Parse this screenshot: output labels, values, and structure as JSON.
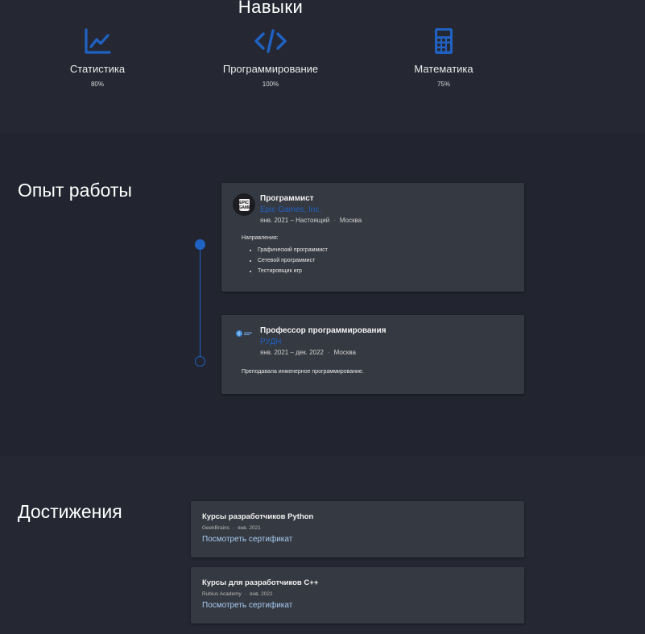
{
  "skills": {
    "title": "Навыки",
    "items": [
      {
        "name": "Статистика",
        "percent": "80%",
        "icon": "chart-line-icon"
      },
      {
        "name": "Программирование",
        "percent": "100%",
        "icon": "code-icon"
      },
      {
        "name": "Математика",
        "percent": "75%",
        "icon": "calculator-icon"
      }
    ]
  },
  "experience": {
    "title": "Опыт работы",
    "jobs": [
      {
        "title": "Программист",
        "company": "Epic Games, Inc.",
        "period": "янв. 2021 – Настоящий",
        "location": "Москва",
        "logo_text": "EPIC GAMES",
        "description_label": "Направления:",
        "duties": [
          "Графический программист",
          "Сетевой программист",
          "Тестировщик игр"
        ]
      },
      {
        "title": "Профессор программирования",
        "company": "РУДН",
        "period": "янв. 2021 – дек. 2022",
        "location": "Москва",
        "description": "Преподавала инженерное программирование."
      }
    ],
    "separator": "·"
  },
  "achievements": {
    "title": "Достижения",
    "items": [
      {
        "title": "Курсы разработчиков Python",
        "issuer": "GeekBrains",
        "date": "янв. 2021",
        "link": "Посмотреть сертификат"
      },
      {
        "title": "Курсы для разработчиков С++",
        "issuer": "Rubius Academy",
        "date": "янв. 2021",
        "link": "Посмотреть сертификат"
      }
    ]
  },
  "colors": {
    "accent": "#1f62c4",
    "link": "#a9cdf5",
    "background": "#252833",
    "card": "#353941"
  }
}
